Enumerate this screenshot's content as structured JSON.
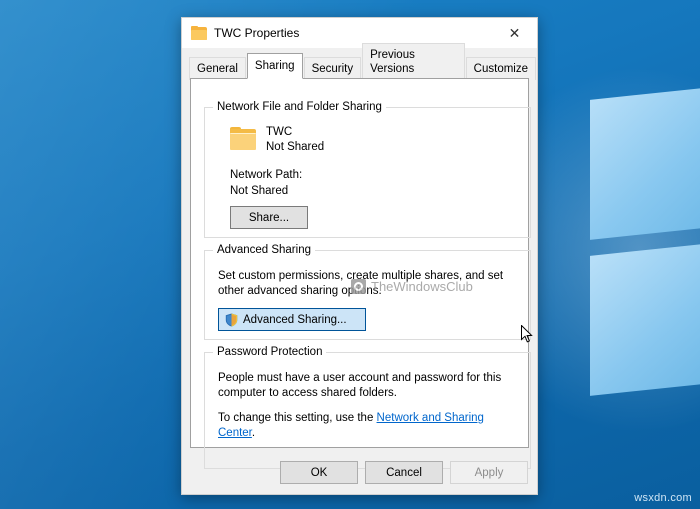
{
  "desktop": {
    "watermark": "wsxdn.com"
  },
  "dialog": {
    "title": "TWC Properties",
    "title_icon": "folder-icon",
    "close_icon": "close-icon",
    "tabs": [
      {
        "label": "General",
        "active": false
      },
      {
        "label": "Sharing",
        "active": true
      },
      {
        "label": "Security",
        "active": false
      },
      {
        "label": "Previous Versions",
        "active": false
      },
      {
        "label": "Customize",
        "active": false
      }
    ],
    "network_group": {
      "legend": "Network File and Folder Sharing",
      "folder_name": "TWC",
      "folder_status": "Not Shared",
      "network_path_label": "Network Path:",
      "network_path_value": "Not Shared",
      "share_button": "Share..."
    },
    "advanced_group": {
      "legend": "Advanced Sharing",
      "description": "Set custom permissions, create multiple shares, and set other advanced sharing options.",
      "button": "Advanced Sharing...",
      "button_icon": "shield-icon"
    },
    "password_group": {
      "legend": "Password Protection",
      "text1": "People must have a user account and password for this computer to access shared folders.",
      "text2_prefix": "To change this setting, use the ",
      "text2_link": "Network and Sharing Center",
      "text2_suffix": "."
    },
    "buttons": {
      "ok": "OK",
      "cancel": "Cancel",
      "apply": "Apply"
    },
    "watermark": "TheWindowsClub"
  }
}
